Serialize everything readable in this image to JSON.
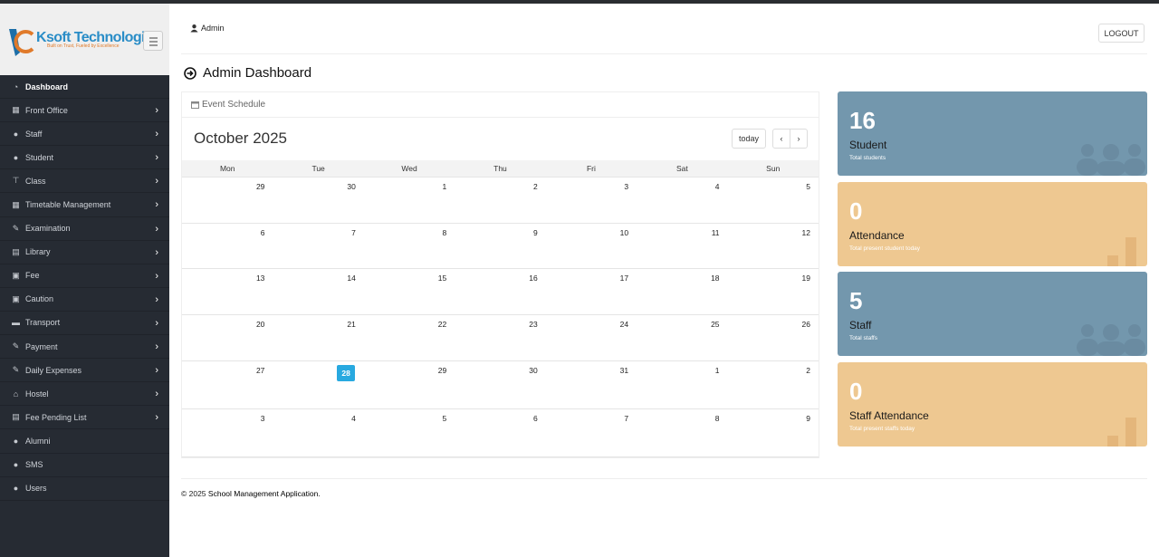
{
  "brand": {
    "name": "Ksoft Technologies",
    "tagline": "Built on Trust, Fueled by Excellence",
    "accent": "#2a8dc7",
    "tag_color": "#e07a2a"
  },
  "sidebar": {
    "items": [
      {
        "label": "Dashboard",
        "icon": "dashboard-icon",
        "chevron": false
      },
      {
        "label": "Front Office",
        "icon": "building-icon",
        "chevron": true
      },
      {
        "label": "Staff",
        "icon": "user-icon",
        "chevron": true
      },
      {
        "label": "Student",
        "icon": "users-icon",
        "chevron": true
      },
      {
        "label": "Class",
        "icon": "sitemap-icon",
        "chevron": true
      },
      {
        "label": "Timetable Management",
        "icon": "table-icon",
        "chevron": true
      },
      {
        "label": "Examination",
        "icon": "edit-icon",
        "chevron": true
      },
      {
        "label": "Library",
        "icon": "book-icon",
        "chevron": true
      },
      {
        "label": "Fee",
        "icon": "money-icon",
        "chevron": true
      },
      {
        "label": "Caution",
        "icon": "money-icon",
        "chevron": true
      },
      {
        "label": "Transport",
        "icon": "truck-icon",
        "chevron": true
      },
      {
        "label": "Payment",
        "icon": "edit-icon",
        "chevron": true
      },
      {
        "label": "Daily Expenses",
        "icon": "edit-icon",
        "chevron": true
      },
      {
        "label": "Hostel",
        "icon": "home-icon",
        "chevron": true
      },
      {
        "label": "Fee Pending List",
        "icon": "file-icon",
        "chevron": true
      },
      {
        "label": "Alumni",
        "icon": "users-icon",
        "chevron": false
      },
      {
        "label": "SMS",
        "icon": "users-icon",
        "chevron": false
      },
      {
        "label": "Users",
        "icon": "user-plus-icon",
        "chevron": false
      }
    ]
  },
  "header": {
    "user": "Admin",
    "logout": "LOGOUT"
  },
  "page": {
    "title": "Admin Dashboard"
  },
  "calendar": {
    "panel_title": "Event Schedule",
    "month": "October 2025",
    "today_label": "today",
    "prev": "‹",
    "next": "›",
    "days_of_week": [
      "Mon",
      "Tue",
      "Wed",
      "Thu",
      "Fri",
      "Sat",
      "Sun"
    ],
    "weeks": [
      [
        "29",
        "30",
        "1",
        "2",
        "3",
        "4",
        "5"
      ],
      [
        "6",
        "7",
        "8",
        "9",
        "10",
        "11",
        "12"
      ],
      [
        "13",
        "14",
        "15",
        "16",
        "17",
        "18",
        "19"
      ],
      [
        "20",
        "21",
        "22",
        "23",
        "24",
        "25",
        "26"
      ],
      [
        "27",
        "28",
        "29",
        "30",
        "31",
        "1",
        "2"
      ],
      [
        "3",
        "4",
        "5",
        "6",
        "7",
        "8",
        "9"
      ]
    ],
    "today": "28",
    "today_color": "#28a9e0"
  },
  "cards": [
    {
      "value": "16",
      "label": "Student",
      "sub": "Total students",
      "color": "#7397ad",
      "icon": "users-icon"
    },
    {
      "value": "0",
      "label": "Attendance",
      "sub": "Total present student today",
      "color": "#eec891",
      "icon": "bar-chart-icon"
    },
    {
      "value": "5",
      "label": "Staff",
      "sub": "Total staffs",
      "color": "#7397ad",
      "icon": "users-icon"
    },
    {
      "value": "0",
      "label": "Staff Attendance",
      "sub": "Total present staffs today",
      "color": "#eec891",
      "icon": "bar-chart-icon"
    }
  ],
  "footer": {
    "copy": "© 2025",
    "app": "School Management Application."
  }
}
